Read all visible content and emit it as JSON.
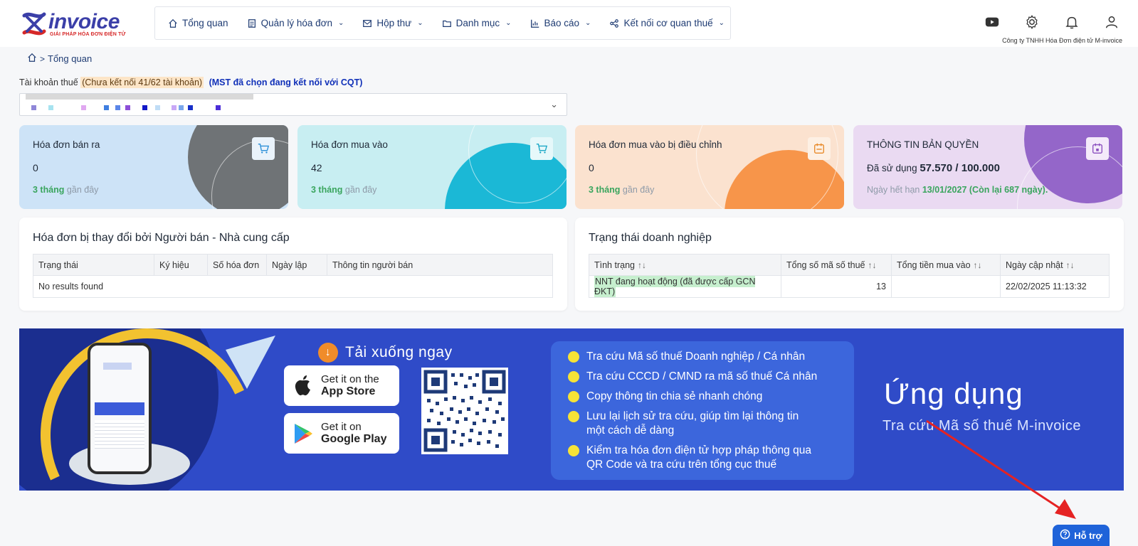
{
  "logo": {
    "word": "invoice",
    "tagline": "GIẢI PHÁP HÓA ĐƠN ĐIỆN TỬ"
  },
  "nav": [
    {
      "label": "Tổng quan",
      "icon": "home-icon",
      "dropdown": false
    },
    {
      "label": "Quản lý hóa đơn",
      "icon": "document-icon",
      "dropdown": true
    },
    {
      "label": "Hộp thư",
      "icon": "mail-icon",
      "dropdown": true
    },
    {
      "label": "Danh mục",
      "icon": "folder-icon",
      "dropdown": true
    },
    {
      "label": "Báo cáo",
      "icon": "chart-icon",
      "dropdown": true
    },
    {
      "label": "Kết nối cơ quan thuế",
      "icon": "share-icon",
      "dropdown": true
    }
  ],
  "header": {
    "company": "Công ty TNHH Hóa Đơn điện tử M-invoice"
  },
  "breadcrumb": {
    "current": "Tổng quan"
  },
  "tax": {
    "label": "Tài khoản thuế",
    "warning": "(Chưa kết nối 41/62 tài khoản)",
    "mst_note": "(MST đã chọn đang kết nối với CQT)"
  },
  "cards": [
    {
      "title": "Hóa đơn bán ra",
      "value": "0",
      "sub_highlight": "3 tháng",
      "sub_rest": " gần đây"
    },
    {
      "title": "Hóa đơn mua vào",
      "value": "42",
      "sub_highlight": "3 tháng",
      "sub_rest": " gần đây"
    },
    {
      "title": "Hóa đơn mua vào bị điều chỉnh",
      "value": "0",
      "sub_highlight": "3 tháng",
      "sub_rest": " gần đây"
    },
    {
      "title": "THÔNG TIN BẢN QUYỀN",
      "value_prefix": "Đã sử dụng ",
      "value": "57.570 / 100.000",
      "sub_prefix": "Ngày hết hạn ",
      "sub_highlight": "13/01/2027 (Còn lại 687 ngày)."
    }
  ],
  "seller_panel": {
    "title": "Hóa đơn bị thay đổi bởi Người bán - Nhà cung cấp",
    "columns": [
      "Trạng thái",
      "Ký hiệu",
      "Số hóa đơn",
      "Ngày lập",
      "Thông tin người bán"
    ],
    "empty": "No results found"
  },
  "status_panel": {
    "title": "Trạng thái doanh nghiệp",
    "columns": [
      "Tình trạng",
      "Tổng số mã số thuế",
      "Tổng tiền mua vào",
      "Ngày cập nhật"
    ],
    "row": {
      "status": "NNT đang hoạt động (đã được cấp GCN ĐKT)",
      "count": "13",
      "amount": "",
      "updated": "22/02/2025 11:13:32"
    }
  },
  "banner": {
    "download_title": "Tải xuống ngay",
    "appstore_line1": "Get it on the",
    "appstore_line2": "App Store",
    "play_line1": "Get it on",
    "play_line2": "Google Play",
    "features": [
      "Tra cứu Mã số thuế Doanh nghiệp / Cá nhân",
      "Tra cứu CCCD / CMND ra mã số thuế Cá nhân",
      "Copy thông tin chia sẻ nhanh chóng",
      "Lưu lại lịch sử tra cứu, giúp tìm lại thông tin",
      "một cách dễ dàng",
      "Kiểm tra hóa đơn điện tử hợp pháp thông qua",
      "QR Code và tra cứu trên tổng cục thuế"
    ],
    "app_title": "Ứng dụng",
    "app_subtitle": "Tra cứu Mã số thuế M-invoice"
  },
  "support": {
    "label": "Hỗ trợ"
  }
}
